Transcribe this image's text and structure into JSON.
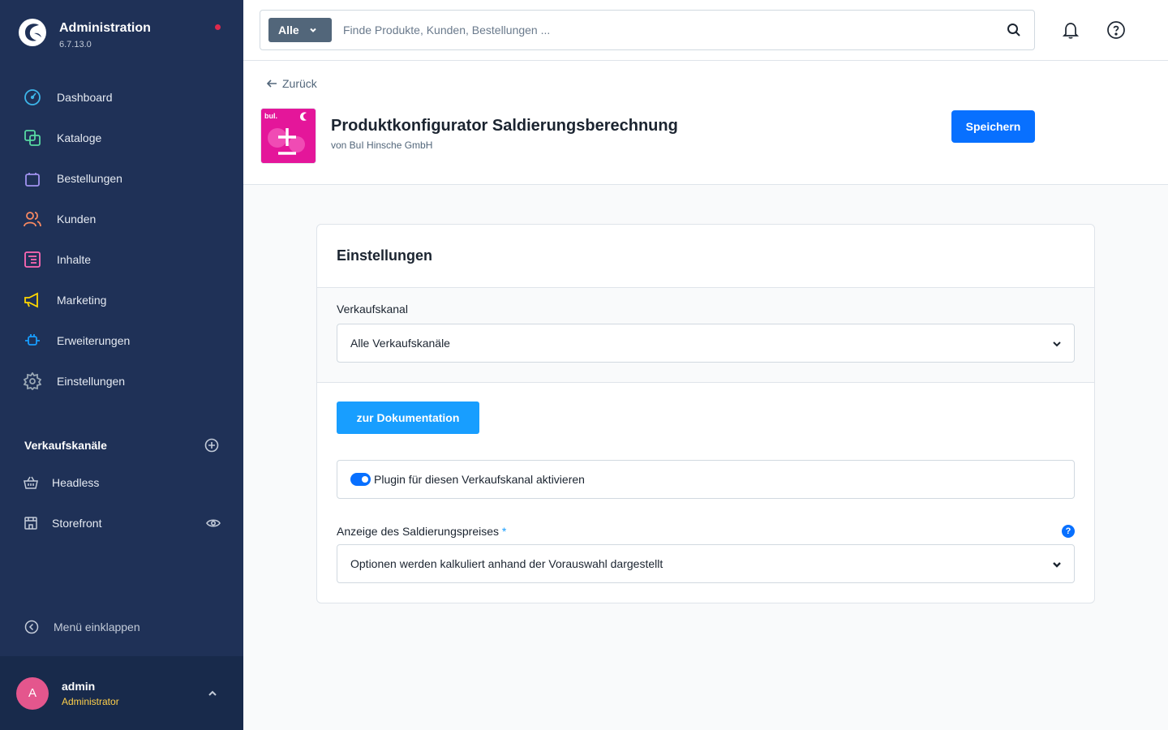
{
  "app": {
    "title": "Administration",
    "version": "6.7.13.0"
  },
  "sidebar": {
    "items": [
      {
        "label": "Dashboard",
        "icon": "dashboard-icon",
        "color": "#3db5e9"
      },
      {
        "label": "Kataloge",
        "icon": "catalog-icon",
        "color": "#57d9a3"
      },
      {
        "label": "Bestellungen",
        "icon": "shopping-bag-icon",
        "color": "#a092f0"
      },
      {
        "label": "Kunden",
        "icon": "customers-icon",
        "color": "#f88962"
      },
      {
        "label": "Inhalte",
        "icon": "content-icon",
        "color": "#ff68b4"
      },
      {
        "label": "Marketing",
        "icon": "megaphone-icon",
        "color": "#ffd700"
      },
      {
        "label": "Erweiterungen",
        "icon": "plug-icon",
        "color": "#189eff"
      },
      {
        "label": "Einstellungen",
        "icon": "gear-icon",
        "color": "#9aa8b5"
      }
    ],
    "sales_channels": {
      "title": "Verkaufskanäle",
      "items": [
        {
          "label": "Headless",
          "icon": "basket-icon"
        },
        {
          "label": "Storefront",
          "icon": "storefront-icon"
        }
      ]
    },
    "collapse_label": "Menü einklappen",
    "user": {
      "initial": "A",
      "name": "admin",
      "role": "Administrator"
    }
  },
  "search": {
    "type_label": "Alle",
    "placeholder": "Finde Produkte, Kunden, Bestellungen ..."
  },
  "header": {
    "back_label": "Zurück",
    "plugin_title": "Produktkonfigurator Saldierungsberechnung",
    "plugin_vendor": "von BuI Hinsche GmbH",
    "plugin_icon_text": "buI.",
    "save_label": "Speichern"
  },
  "card": {
    "title": "Einstellungen",
    "sales_channel_label": "Verkaufskanal",
    "sales_channel_value": "Alle Verkaufskanäle",
    "doc_button_label": "zur Dokumentation",
    "toggle_label": "Plugin für diesen Verkaufskanal aktivieren",
    "toggle_on": true,
    "display_label": "Anzeige des Saldierungspreises",
    "required_mark": "*",
    "help_symbol": "?",
    "display_value": "Optionen werden kalkuliert anhand der Vorauswahl dargestellt"
  },
  "colors": {
    "sidebar_bg": "#1f3157",
    "primary": "#0870ff",
    "doc_button": "#189eff",
    "plugin_icon_bg": "#e4169a"
  }
}
